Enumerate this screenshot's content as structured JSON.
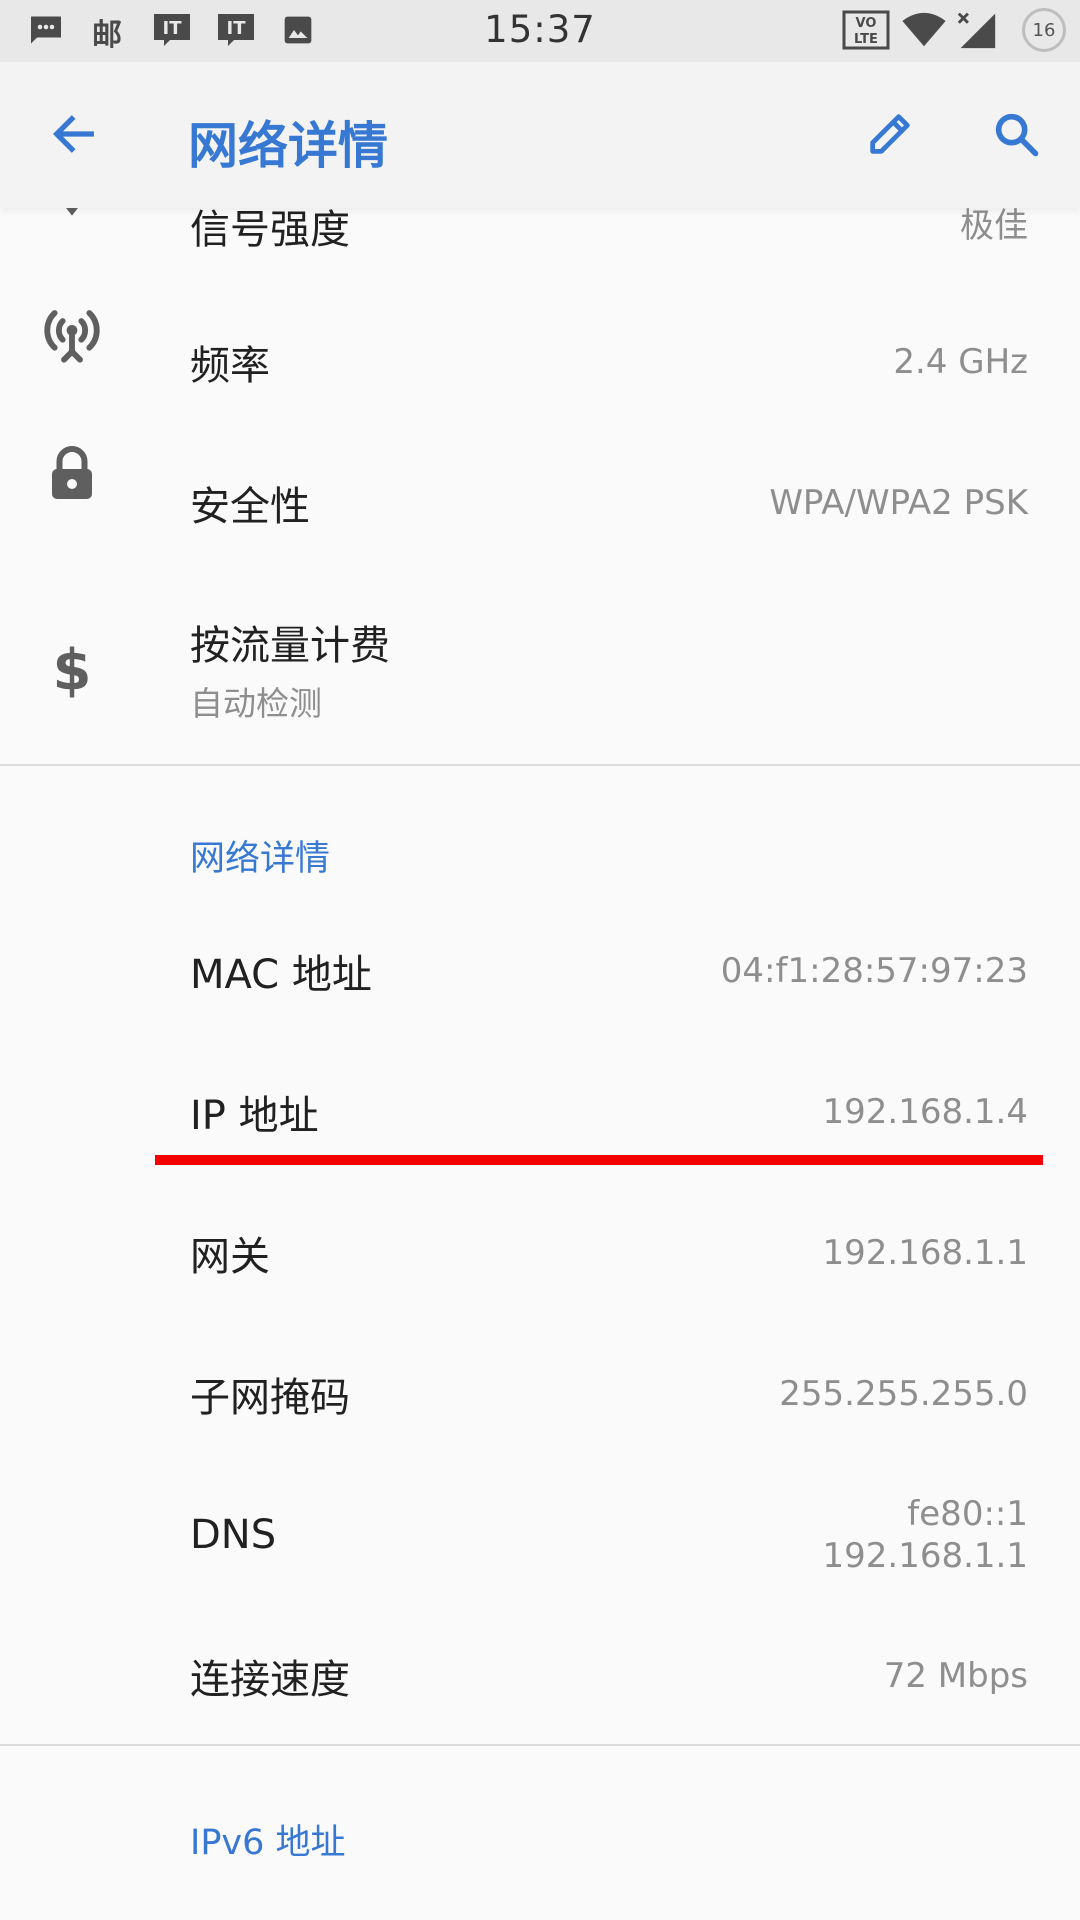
{
  "status_bar": {
    "time": "15:37",
    "left_icons": [
      "message-icon",
      "mail-icon",
      "notification-it-icon",
      "notification-it-icon",
      "image-icon"
    ],
    "carrier_char": "邮",
    "it_label": "IT",
    "volte_label_top": "VO",
    "volte_label_bottom": "LTE",
    "battery_level": "16"
  },
  "app_bar": {
    "title": "网络详情",
    "back_icon": "arrow-back-icon",
    "edit_icon": "pencil-icon",
    "search_icon": "search-icon",
    "accent": "#3778d3"
  },
  "rows_top": [
    {
      "label": "信号强度",
      "value": "极佳",
      "icon": "signal-icon"
    },
    {
      "label": "频率",
      "value": "2.4 GHz",
      "icon": "antenna-icon"
    },
    {
      "label": "安全性",
      "value": "WPA/WPA2 PSK",
      "icon": "lock-icon"
    },
    {
      "label": "按流量计费",
      "sub": "自动检测",
      "icon": "dollar-icon"
    }
  ],
  "section_network": {
    "header": "网络详情",
    "rows": [
      {
        "label": "MAC 地址",
        "value": "04:f1:28:57:97:23"
      },
      {
        "label": "IP 地址",
        "value": "192.168.1.4"
      },
      {
        "label": "网关",
        "value": "192.168.1.1"
      },
      {
        "label": "子网掩码",
        "value": "255.255.255.0"
      },
      {
        "label": "DNS",
        "value_line1": "fe80::1",
        "value_line2": "192.168.1.1"
      },
      {
        "label": "连接速度",
        "value": "72 Mbps"
      }
    ]
  },
  "section_ipv6": {
    "header": "IPv6 地址"
  },
  "colors": {
    "annotation_red": "#f40000",
    "primary_text": "#212121",
    "secondary_text": "#8e8e8e"
  }
}
